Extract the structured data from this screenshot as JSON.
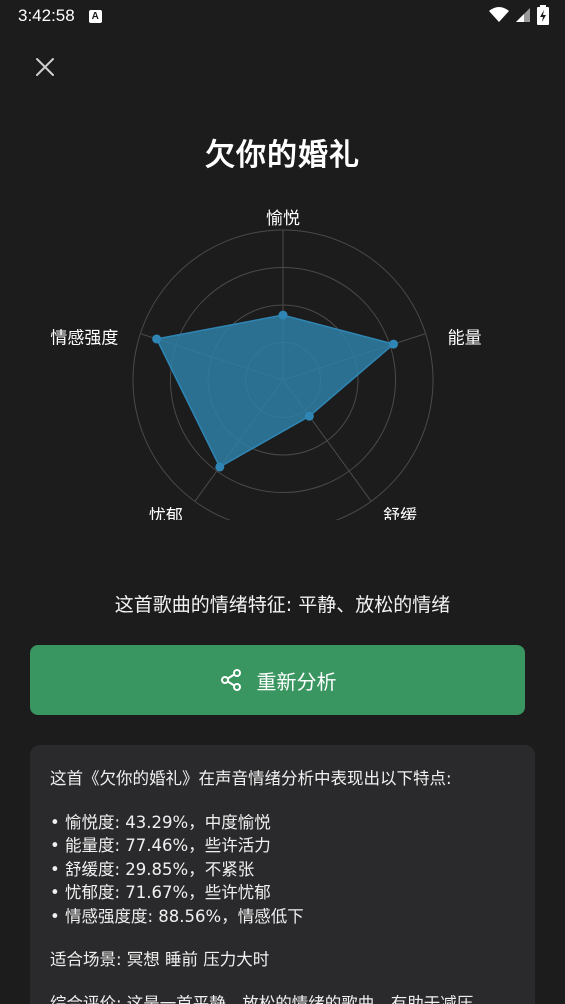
{
  "status_bar": {
    "time": "3:42:58",
    "badge": "A"
  },
  "header": {
    "close_icon": "close-icon"
  },
  "song_title": "欠你的婚礼",
  "chart_data": {
    "type": "radar",
    "axes": [
      "愉悦",
      "能量",
      "舒缓",
      "忧郁",
      "情感强度"
    ],
    "values": [
      43.29,
      77.46,
      29.85,
      71.67,
      88.56
    ],
    "range": [
      0,
      100
    ],
    "rings": 4,
    "fill_color": "#2e7fa6",
    "point_color": "#2f86b4"
  },
  "summary": "这首歌曲的情绪特征: 平静、放松的情绪",
  "reanalyze_button": {
    "label": "重新分析",
    "icon": "share-icon",
    "color": "#399660"
  },
  "analysis": {
    "intro": "这首《欠你的婚礼》在声音情绪分析中表现出以下特点:",
    "items": [
      "愉悦度: 43.29%，中度愉悦",
      "能量度: 77.46%，些许活力",
      "舒缓度: 29.85%，不紧张",
      "忧郁度: 71.67%，些许忧郁",
      "情感强度度: 88.56%，情感低下"
    ],
    "scenes": "适合场景: 冥想   睡前   压力大时",
    "evaluation": "综合评价: 这是一首平静、放松的情绪的歌曲，有助于减压"
  }
}
